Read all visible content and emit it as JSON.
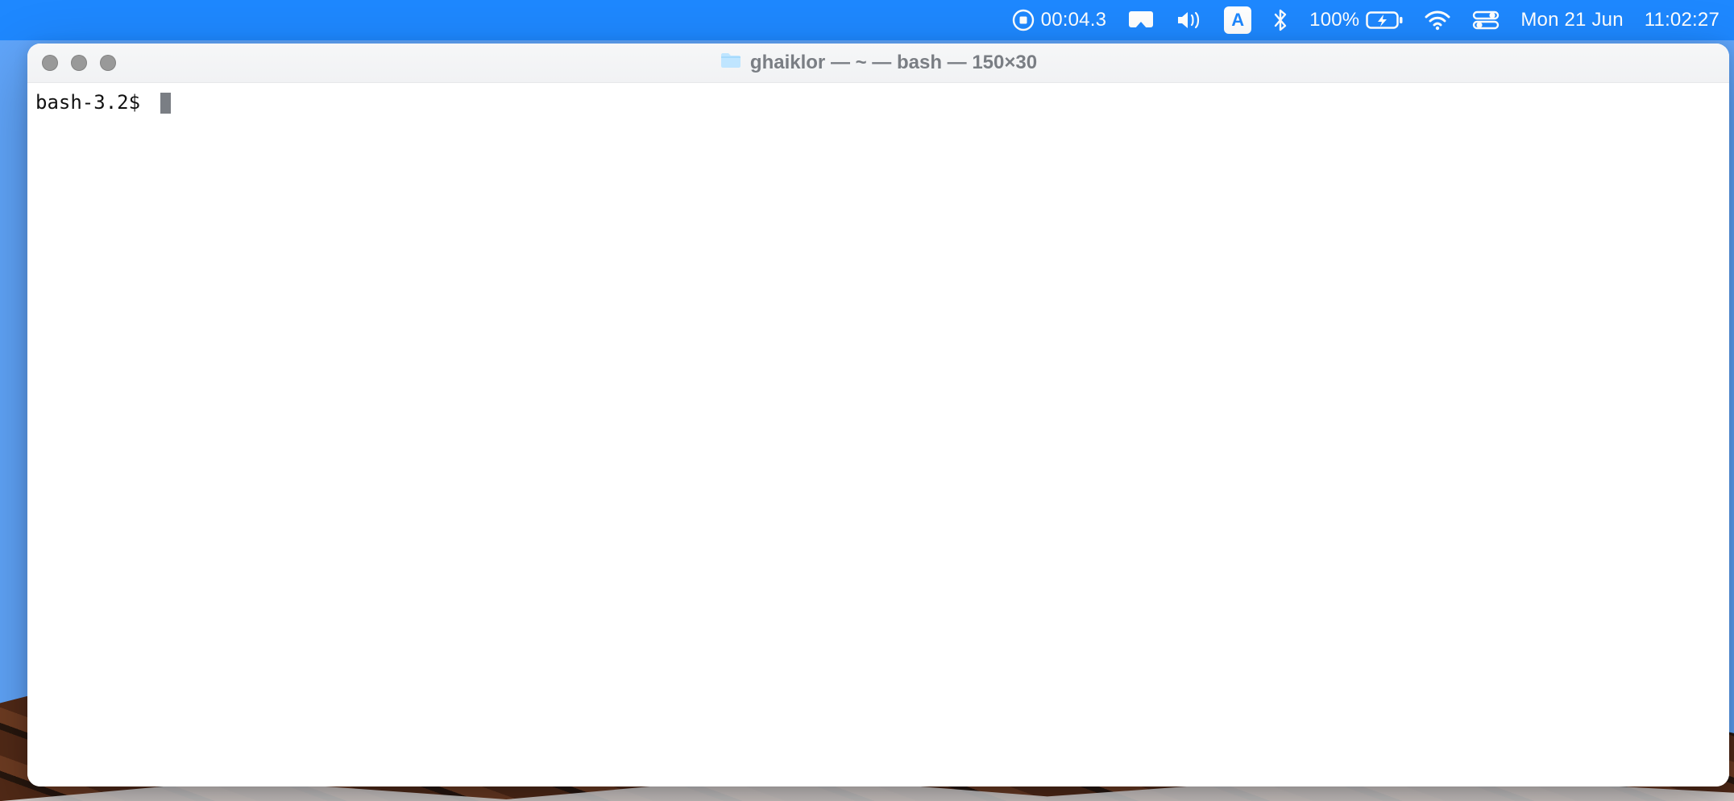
{
  "menubar": {
    "recording_timer": "00:04.3",
    "input_source_label": "A",
    "battery_percent": "100%",
    "date": "Mon 21 Jun",
    "time": "11:02:27"
  },
  "window": {
    "title": "ghaiklor — ~ — bash — 150×30"
  },
  "terminal": {
    "prompt": "bash-3.2$ "
  }
}
